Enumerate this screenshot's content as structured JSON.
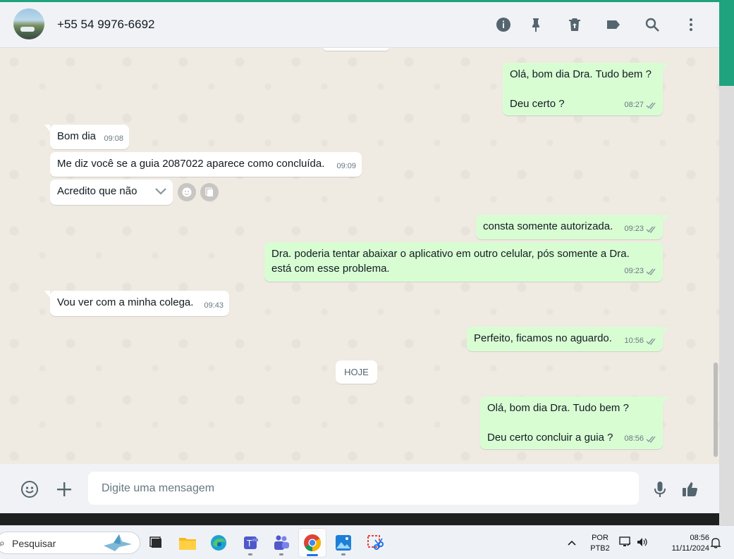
{
  "contact": {
    "name": "+55 54 9976-6692"
  },
  "header_icons": [
    "info-icon",
    "pin-icon",
    "trash-icon",
    "label-icon",
    "search-icon",
    "more-vert-icon"
  ],
  "messages": [
    {
      "dir": "out",
      "text": "Olá, bom dia Dra. Tudo bem ?\n\nDeu certo ?",
      "time": "08:27"
    },
    {
      "dir": "in",
      "text": "Bom dia",
      "time": "09:08"
    },
    {
      "dir": "in",
      "text": "Me diz você se a guia 2087022 aparece como concluída.",
      "time": "09:09"
    },
    {
      "dir": "in",
      "text": "Acredito que não",
      "time": ""
    },
    {
      "dir": "out",
      "text": "consta somente autorizada.",
      "time": "09:23"
    },
    {
      "dir": "out",
      "text": "Dra. poderia tentar abaixar o aplicativo em outro celular, pós somente a Dra.\nestá com esse problema.",
      "time": "09:23"
    },
    {
      "dir": "in",
      "text": "Vou ver com a minha colega.",
      "time": "09:43"
    },
    {
      "dir": "out",
      "text": "Perfeito, ficamos no aguardo.",
      "time": "10:56"
    },
    {
      "dir": "out",
      "text": "Olá, bom dia Dra. Tudo bem ?\n\nDeu certo concluir a guia ?",
      "time": "08:56"
    }
  ],
  "date_chip": "HOJE",
  "composer": {
    "placeholder": "Digite uma mensagem"
  },
  "taskbar": {
    "search_label": "Pesquisar",
    "language": "POR",
    "keyboard": "PTB2",
    "time": "08:56",
    "date": "11/11/2024"
  },
  "colors": {
    "outgoing": "#d9fdd3",
    "incoming": "#ffffff",
    "accent": "#1fa37f",
    "tick": "#8696a0"
  }
}
